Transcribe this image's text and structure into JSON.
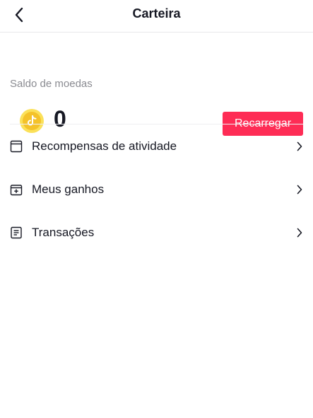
{
  "header": {
    "title": "Carteira",
    "back_icon": "chevron-left-icon"
  },
  "balance": {
    "label": "Saldo de moedas",
    "value": "0",
    "coin_icon": "tiktok-coin-icon",
    "recharge_label": "Recarregar"
  },
  "menu": {
    "items": [
      {
        "label": "Recompensas de atividade",
        "icon": "reward-box-icon"
      },
      {
        "label": "Meus ganhos",
        "icon": "earnings-icon"
      },
      {
        "label": "Transações",
        "icon": "document-icon"
      }
    ]
  },
  "colors": {
    "accent": "#fe2c55",
    "coin": "#fbe15a",
    "text": "#161823",
    "muted": "#8a8b91"
  }
}
